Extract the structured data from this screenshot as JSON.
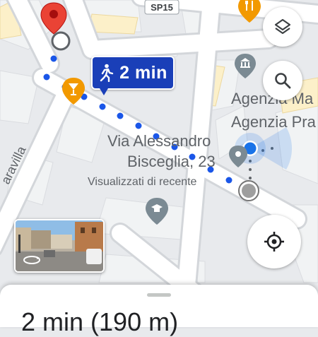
{
  "map": {
    "route_badge": {
      "time": "2 min",
      "icon": "walking-person-icon",
      "color": "#1a3fb8"
    },
    "labels": {
      "road_shield": "SP15",
      "street_left": "aravilla",
      "agency_line1": "Agenzia Ma",
      "agency_line2": "Agenzia Pra",
      "address_line1": "Via Alessandro",
      "address_line2": "Bisceglia, 23",
      "recent_label": "Visualizzati di recente"
    },
    "pins": {
      "destination": "red-location-pin-icon",
      "bar": "cocktail-bar-icon",
      "restaurant": "fork-knife-icon",
      "museum": "museum-icon",
      "school": "graduation-cap-icon"
    },
    "colors": {
      "route_dots": "#1a56e8",
      "current_location": "#1a73e8",
      "destination_pin": "#ea4335",
      "poi_orange": "#f29900"
    }
  },
  "controls": {
    "layers_icon": "layers-icon",
    "search_icon": "search-icon",
    "locate_icon": "my-location-icon",
    "streetview_icon": "360-rotate-icon"
  },
  "sheet": {
    "summary": "2 min (190 m)"
  }
}
